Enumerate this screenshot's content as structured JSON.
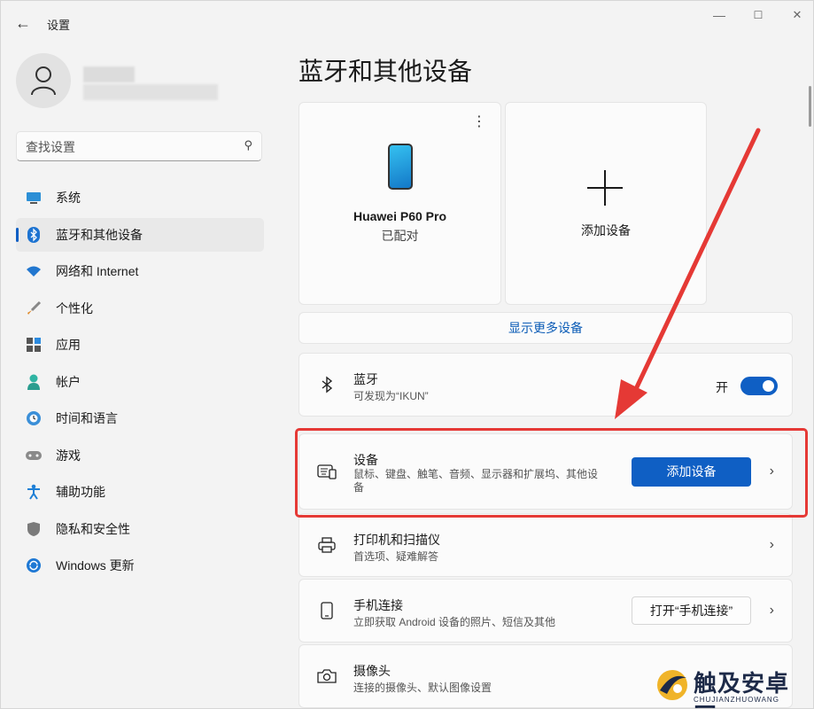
{
  "window": {
    "title": "设置",
    "minimize": "—",
    "maximize": "☐",
    "close": "✕"
  },
  "search": {
    "placeholder": "查找设置"
  },
  "sidebar": {
    "items": [
      {
        "label": "系统",
        "icon": "monitor-icon"
      },
      {
        "label": "蓝牙和其他设备",
        "icon": "bluetooth-icon"
      },
      {
        "label": "网络和 Internet",
        "icon": "wifi-icon"
      },
      {
        "label": "个性化",
        "icon": "brush-icon"
      },
      {
        "label": "应用",
        "icon": "apps-icon"
      },
      {
        "label": "帐户",
        "icon": "account-icon"
      },
      {
        "label": "时间和语言",
        "icon": "clock-globe-icon"
      },
      {
        "label": "游戏",
        "icon": "gamepad-icon"
      },
      {
        "label": "辅助功能",
        "icon": "accessibility-icon"
      },
      {
        "label": "隐私和安全性",
        "icon": "shield-icon"
      },
      {
        "label": "Windows 更新",
        "icon": "update-icon"
      }
    ],
    "active_index": 1
  },
  "main": {
    "title": "蓝牙和其他设备",
    "device_card": {
      "name": "Huawei P60 Pro",
      "status": "已配对"
    },
    "add_card": {
      "label": "添加设备"
    },
    "show_more": "显示更多设备",
    "bluetooth": {
      "title": "蓝牙",
      "subtitle": "可发现为“IKUN”",
      "toggle_label": "开",
      "on": true
    },
    "devices": {
      "title": "设备",
      "subtitle_line1": "鼠标、键盘、触笔、音频、显示器和扩展坞、其他设",
      "subtitle_line2": "备",
      "button": "添加设备"
    },
    "printers": {
      "title": "打印机和扫描仪",
      "subtitle": "首选项、疑难解答"
    },
    "phone_link": {
      "title": "手机连接",
      "subtitle": "立即获取 Android 设备的照片、短信及其他",
      "button": "打开“手机连接”"
    },
    "camera": {
      "title": "摄像头",
      "subtitle": "连接的摄像头、默认图像设置"
    }
  },
  "watermark": {
    "text": "触及安卓网",
    "sub": "CHUJIANZHUOWANG"
  },
  "colors": {
    "accent": "#0f5fc4",
    "highlight": "#e53935",
    "background": "#f3f3f3"
  }
}
